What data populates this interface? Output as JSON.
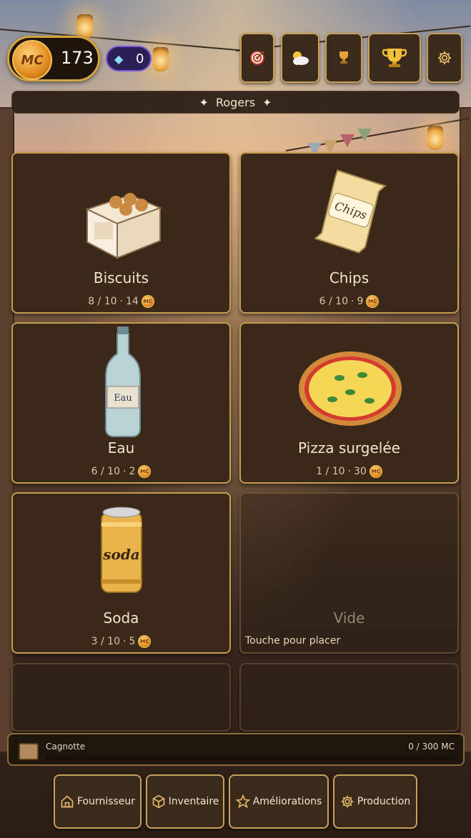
{
  "hud": {
    "coin_badge": "MC",
    "coins": "173",
    "gems": "0"
  },
  "top_buttons": [
    {
      "name": "objectives",
      "icon": "target-icon"
    },
    {
      "name": "weather",
      "icon": "weather-icon"
    },
    {
      "name": "trophy",
      "icon": "trophy-icon"
    },
    {
      "name": "ranking",
      "icon": "cup-icon"
    },
    {
      "name": "settings",
      "icon": "gear-icon"
    }
  ],
  "shop": {
    "owner_name": "Rogers",
    "star": "✦"
  },
  "slots": [
    {
      "title": "Biscuits",
      "stock": "8 / 10",
      "price": "14"
    },
    {
      "title": "Chips",
      "stock": "6 / 10",
      "price": "9"
    },
    {
      "title": "Eau",
      "stock": "6 / 10",
      "price": "2",
      "bottle_label": "Eau"
    },
    {
      "title": "Pizza surgelée",
      "stock": "1 / 10",
      "price": "30"
    },
    {
      "title": "Soda",
      "stock": "3 / 10",
      "price": "5",
      "can_label": "soda"
    },
    {
      "title": "Vide",
      "hint": "Touche pour placer"
    }
  ],
  "chips_label": "Chips",
  "jackpot": {
    "label": "Cagnotte",
    "value": "0 / 300 MC",
    "progress": 0
  },
  "nav": {
    "supplier": "Fournisseur",
    "inventory": "Inventaire",
    "upgrades": "Améliorations",
    "production": "Production"
  },
  "colors": {
    "accent": "#c9a05a",
    "panel": "#3a2818",
    "gold": "#d4a43e"
  }
}
